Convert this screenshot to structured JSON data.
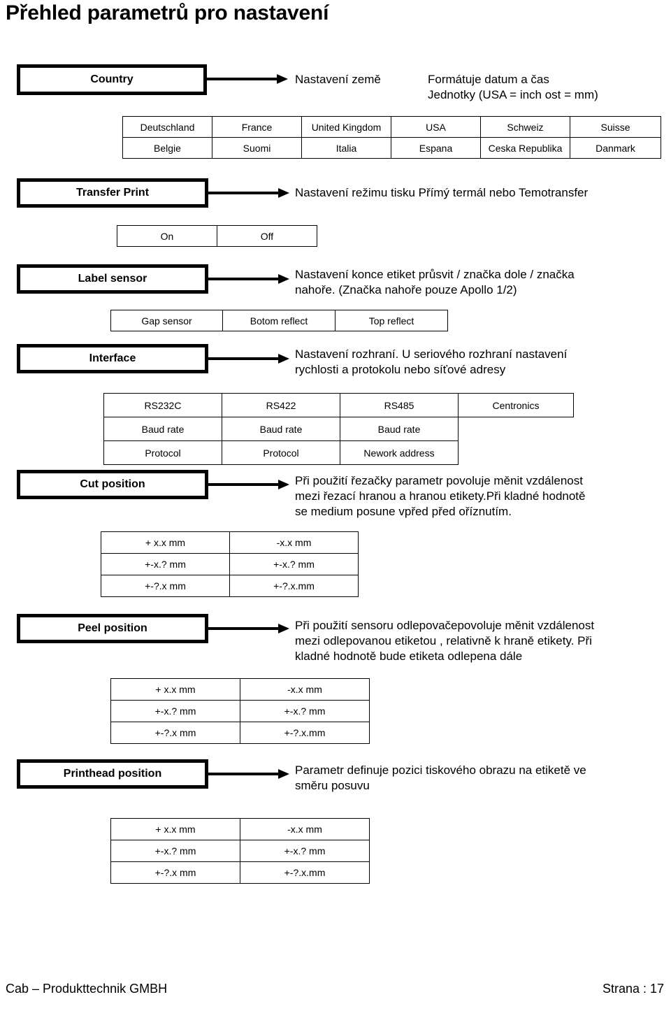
{
  "document": {
    "title": "Přehled parametrů pro nastavení"
  },
  "sections": [
    {
      "key": "country",
      "label": "Country",
      "desc_left": "Nastavení země",
      "desc_right": [
        "Formátuje datum a čas",
        "Jednotky (USA = inch ost = mm)"
      ],
      "table": {
        "rows": [
          [
            "Deutschland",
            "France",
            "United Kingdom",
            "USA",
            "Schweiz",
            "Suisse"
          ],
          [
            "Belgie",
            "Suomi",
            "Italia",
            "Espana",
            "Ceska Republika",
            "Danmark"
          ]
        ]
      }
    },
    {
      "key": "transfer-print",
      "label": "Transfer Print",
      "desc": [
        "Nastavení režimu tisku Přímý termál nebo Temotransfer"
      ],
      "table": {
        "rows": [
          [
            "On",
            "Off"
          ]
        ]
      }
    },
    {
      "key": "label-sensor",
      "label": "Label sensor",
      "desc": [
        "Nastavení konce etiket průsvit / značka dole / značka",
        "nahoře. (Značka nahoře pouze Apollo 1/2)"
      ],
      "table": {
        "rows": [
          [
            "Gap sensor",
            "Botom reflect",
            "Top reflect"
          ]
        ]
      }
    },
    {
      "key": "interface",
      "label": "Interface",
      "desc": [
        "Nastavení rozhraní. U seriového rozhraní nastavení",
        "rychlosti a protokolu nebo síťové adresy"
      ],
      "table": {
        "rows": [
          [
            "RS232C",
            "RS422",
            "RS485",
            "Centronics"
          ],
          [
            "Baud rate",
            "Baud rate",
            "Baud rate",
            ""
          ],
          [
            "Protocol",
            "Protocol",
            "Nework address",
            ""
          ]
        ]
      }
    },
    {
      "key": "cut-position",
      "label": "Cut position",
      "desc": [
        "Při použití řezačky parametr povoluje měnit vzdálenost",
        "mezi řezací hranou a hranou etikety.Při kladné hodnotě",
        "se medium posune vpřed před oříznutím."
      ],
      "table": {
        "rows": [
          [
            "+ x.x mm",
            "-x.x mm"
          ],
          [
            "+-x.? mm",
            "+-x.? mm"
          ],
          [
            "+-?.x mm",
            "+-?.x.mm"
          ]
        ]
      }
    },
    {
      "key": "peel-position",
      "label": "Peel position",
      "desc": [
        "Při použití sensoru odlepovačepovoluje měnit vzdálenost",
        "mezi odlepovanou etiketou , relativně k hraně etikety. Při",
        "kladné hodnotě bude etiketa odlepena dále"
      ],
      "table": {
        "rows": [
          [
            "+ x.x mm",
            "-x.x mm"
          ],
          [
            "+-x.? mm",
            "+-x.? mm"
          ],
          [
            "+-?.x mm",
            "+-?.x.mm"
          ]
        ]
      }
    },
    {
      "key": "printhead-position",
      "label": "Printhead position",
      "desc": [
        "Parametr definuje pozici tiskového obrazu na etiketě ve",
        "směru posuvu"
      ],
      "table": {
        "rows": [
          [
            "+ x.x mm",
            "-x.x mm"
          ],
          [
            "+-x.? mm",
            "+-x.? mm"
          ],
          [
            "+-?.x mm",
            "+-?.x.mm"
          ]
        ]
      }
    }
  ],
  "footer": {
    "company": "Cab – Produkttechnik GMBH",
    "page": "Strana : 17"
  }
}
